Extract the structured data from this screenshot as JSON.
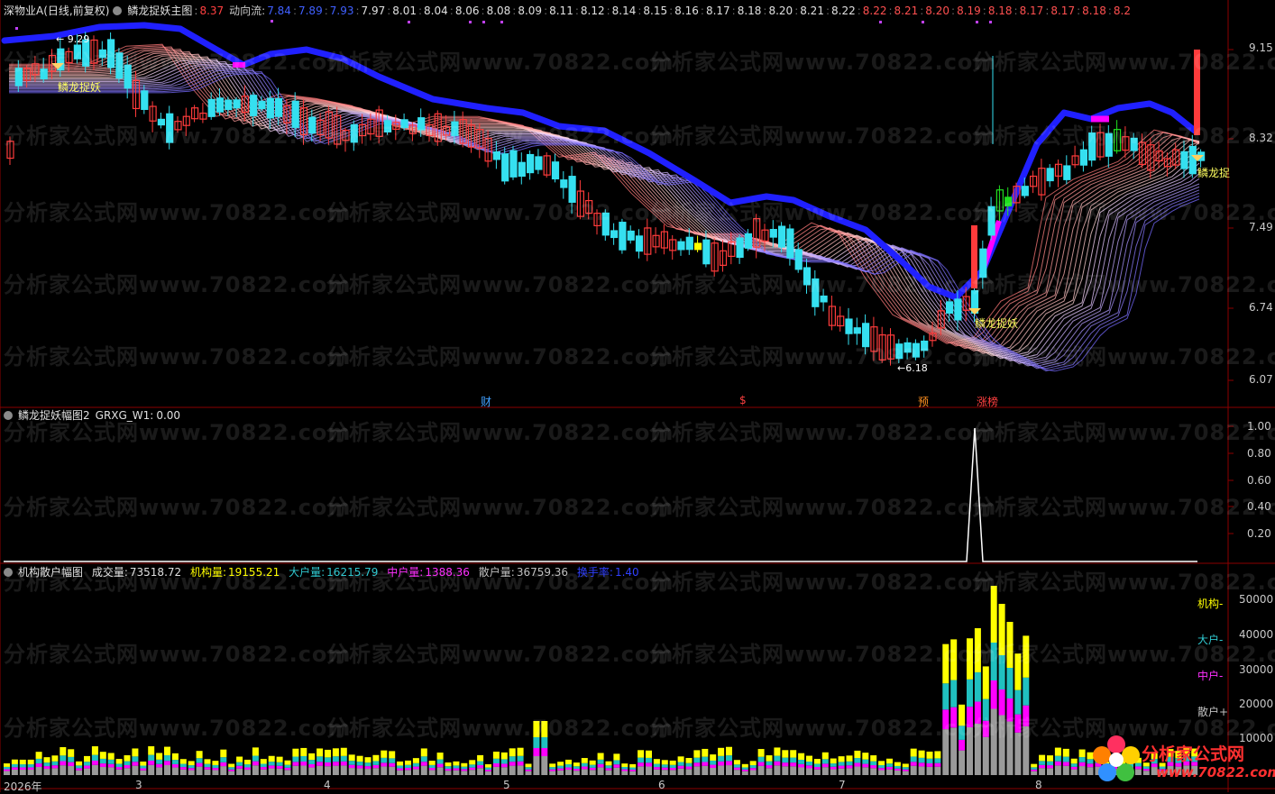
{
  "colors": {
    "up": "#ff3b3b",
    "down": "#35e0f0",
    "blueLine": "#2020ff",
    "bg": "#000000",
    "yellow": "#ffff00",
    "magenta": "#ff00ff",
    "grey": "#9a9a9a",
    "cyan": "#20c0c0"
  },
  "main": {
    "title": "深物业A(日线,前复权)",
    "indicator": "鳞龙捉妖主图",
    "dyl_label": "动向流:",
    "dyl_first": "8.37",
    "dyl_values": [
      "7.84",
      "7.89",
      "7.93",
      "7.97",
      "8.01",
      "8.04",
      "8.06",
      "8.08",
      "8.09",
      "8.11",
      "8.12",
      "8.14",
      "8.15",
      "8.16",
      "8.17",
      "8.18",
      "8.20",
      "8.21",
      "8.22",
      "8.22",
      "8.21",
      "8.20",
      "8.19",
      "8.18",
      "8.17",
      "8.17",
      "8.18",
      "8.2"
    ],
    "yticks": [
      "9.15",
      "8.32",
      "7.49",
      "6.74",
      "6.07"
    ],
    "high_label": "9.29",
    "low_label": "6.18",
    "signal_texts": [
      "鳞龙捉妖",
      "鳞龙捉妖",
      "鳞龙捉"
    ],
    "event_marks": [
      "财",
      "$",
      "预",
      "涨榜"
    ]
  },
  "sub1": {
    "title": "鳞龙捉妖幅图2",
    "field": "GRXG_W1:",
    "value": "0.00",
    "yticks": [
      "1.00",
      "0.80",
      "0.60",
      "0.40",
      "0.20"
    ]
  },
  "sub2": {
    "title": "机构散户幅图",
    "items": [
      {
        "label": "成交量:",
        "value": "73518.72"
      },
      {
        "label": "机构量:",
        "value": "19155.21"
      },
      {
        "label": "大户量:",
        "value": "16215.79"
      },
      {
        "label": "中户量:",
        "value": "1388.36"
      },
      {
        "label": "散户量:",
        "value": "36759.36"
      },
      {
        "label": "换手率:",
        "value": "1.40"
      }
    ],
    "yticks": [
      "50000",
      "40000",
      "30000",
      "20000",
      "10000"
    ],
    "legend": [
      "机构-",
      "大户-",
      "中户-",
      "散户+"
    ]
  },
  "xaxis": [
    "2026年",
    "3",
    "4",
    "5",
    "6",
    "7",
    "8"
  ],
  "watermark": "分析家公式网www.70822.com",
  "logo": {
    "name": "分析家公式网",
    "url": "www.70822.com"
  }
}
